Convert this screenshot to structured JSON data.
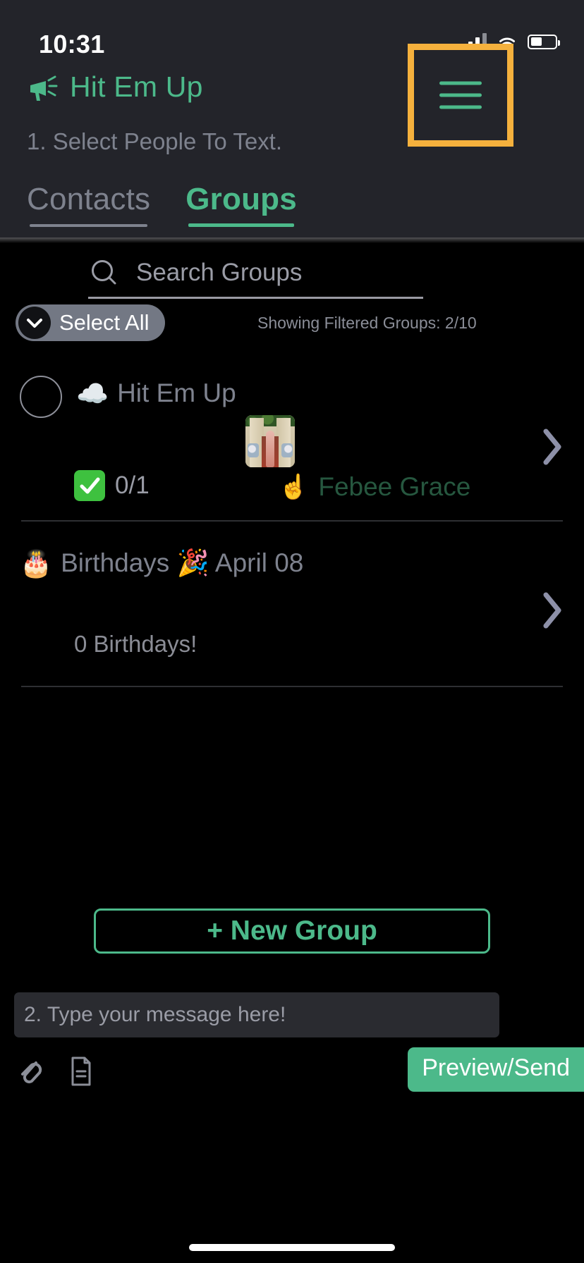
{
  "status_bar": {
    "time": "10:31",
    "signal_icon": "cellular-bars-icon",
    "wifi_icon": "wifi-icon",
    "battery_icon": "battery-icon"
  },
  "header": {
    "app_icon": "megaphone-icon",
    "app_title": "Hit Em Up",
    "step_label": "1. Select People To Text.",
    "menu_icon": "hamburger-menu-icon",
    "menu_highlight_color": "#f5b13d",
    "accent_color": "#4cb98a",
    "muted_color": "#7e828e",
    "tabs": [
      {
        "label": "Contacts",
        "active": false
      },
      {
        "label": "Groups",
        "active": true
      }
    ]
  },
  "search": {
    "icon": "search-icon",
    "placeholder": "Search Groups",
    "value": ""
  },
  "toolbar": {
    "select_all_label": "Select All",
    "select_all_icon": "chevron-down-icon",
    "filter_status": "Showing Filtered Groups: 2/10"
  },
  "groups": [
    {
      "checkbox_checked": false,
      "emoji": "☁️",
      "name": "Hit Em Up",
      "thumbnail": "wedding-photo-thumbnail",
      "count_badge_icon": "green-check-icon",
      "count": "0/1",
      "member_emoji": "☝️",
      "member_name": "Febee Grace",
      "chevron_icon": "chevron-right-icon"
    },
    {
      "checkbox_checked": false,
      "emoji": "🎂",
      "name": "Birthdays 🎉 April 08",
      "empty_note": "0 Birthdays!",
      "chevron_icon": "chevron-right-icon"
    }
  ],
  "new_group_button": {
    "label": "+ New Group"
  },
  "message_input": {
    "placeholder": "2. Type your message here!",
    "value": ""
  },
  "bottom_bar": {
    "attach_icon": "paperclip-icon",
    "document_icon": "document-icon",
    "send_label": "Preview/Send"
  }
}
